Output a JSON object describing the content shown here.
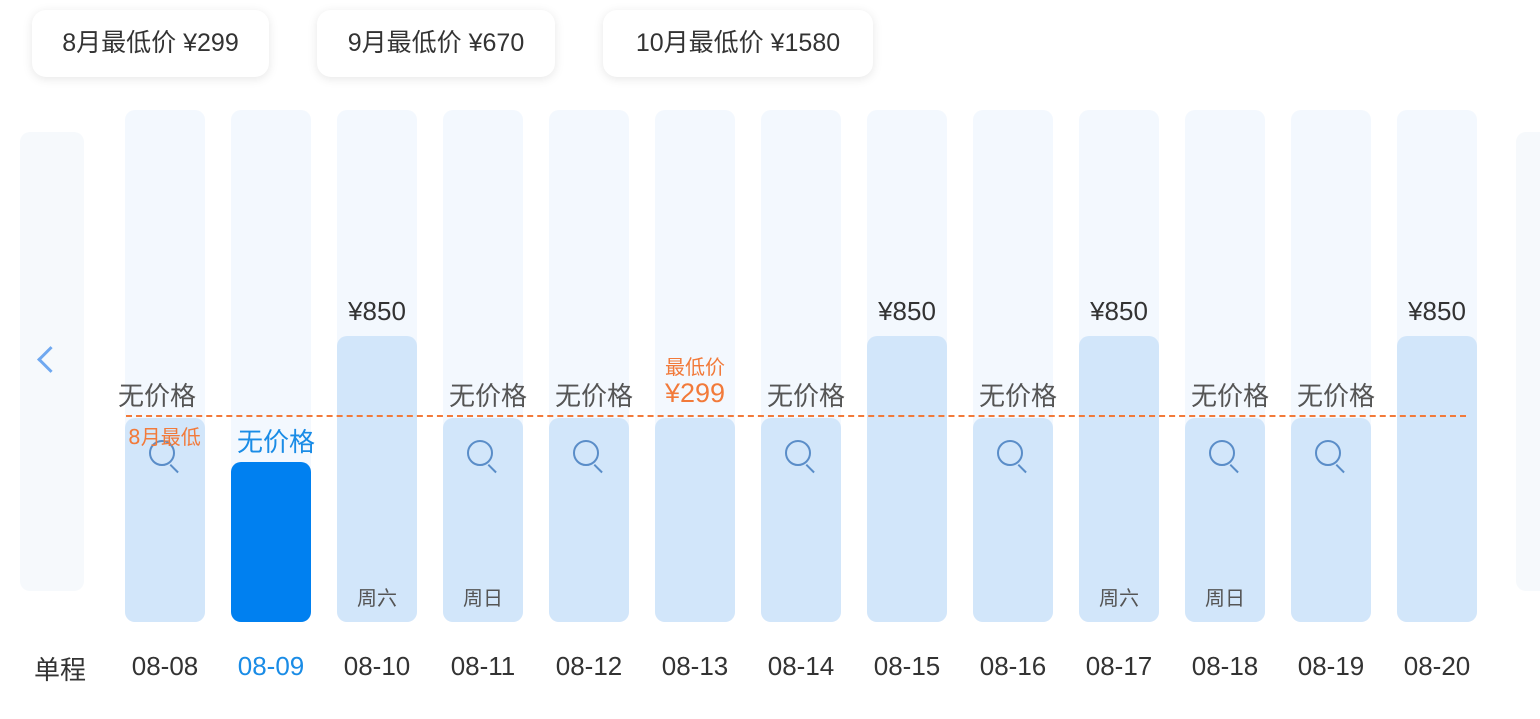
{
  "month_chips": [
    {
      "label": "8月最低价 ¥299"
    },
    {
      "label": "9月最低价 ¥670"
    },
    {
      "label": "10月最低价 ¥1580"
    }
  ],
  "trip_type": "单程",
  "min_line_label": "8月最低",
  "lowest_tag": "最低价",
  "no_price_label": "无价格",
  "days": [
    {
      "date": "08-08",
      "price": null,
      "no_price": "无价格",
      "weekday": "",
      "selected": false,
      "searchable": true
    },
    {
      "date": "08-09",
      "price": null,
      "no_price": "无价格",
      "weekday": "",
      "selected": true,
      "searchable": false
    },
    {
      "date": "08-10",
      "price": "¥850",
      "no_price": "",
      "weekday": "周六",
      "selected": false,
      "searchable": false
    },
    {
      "date": "08-11",
      "price": null,
      "no_price": "无价格",
      "weekday": "周日",
      "selected": false,
      "searchable": true
    },
    {
      "date": "08-12",
      "price": null,
      "no_price": "无价格",
      "weekday": "",
      "selected": false,
      "searchable": true
    },
    {
      "date": "08-13",
      "price": "¥299",
      "no_price": "",
      "weekday": "",
      "selected": false,
      "searchable": false,
      "lowest": true
    },
    {
      "date": "08-14",
      "price": null,
      "no_price": "无价格",
      "weekday": "",
      "selected": false,
      "searchable": true
    },
    {
      "date": "08-15",
      "price": "¥850",
      "no_price": "",
      "weekday": "",
      "selected": false,
      "searchable": false
    },
    {
      "date": "08-16",
      "price": null,
      "no_price": "无价格",
      "weekday": "",
      "selected": false,
      "searchable": true
    },
    {
      "date": "08-17",
      "price": "¥850",
      "no_price": "",
      "weekday": "周六",
      "selected": false,
      "searchable": false
    },
    {
      "date": "08-18",
      "price": null,
      "no_price": "无价格",
      "weekday": "周日",
      "selected": false,
      "searchable": true
    },
    {
      "date": "08-19",
      "price": null,
      "no_price": "无价格",
      "weekday": "",
      "selected": false,
      "searchable": true
    },
    {
      "date": "08-20",
      "price": "¥850",
      "no_price": "",
      "weekday": "",
      "selected": false,
      "searchable": false
    }
  ],
  "colors": {
    "accent": "#0080f0",
    "bar": "#d2e6fa",
    "column_bg": "#f3f8fe",
    "lowest": "#f27a3a",
    "selected_text": "#1a8ce6"
  }
}
